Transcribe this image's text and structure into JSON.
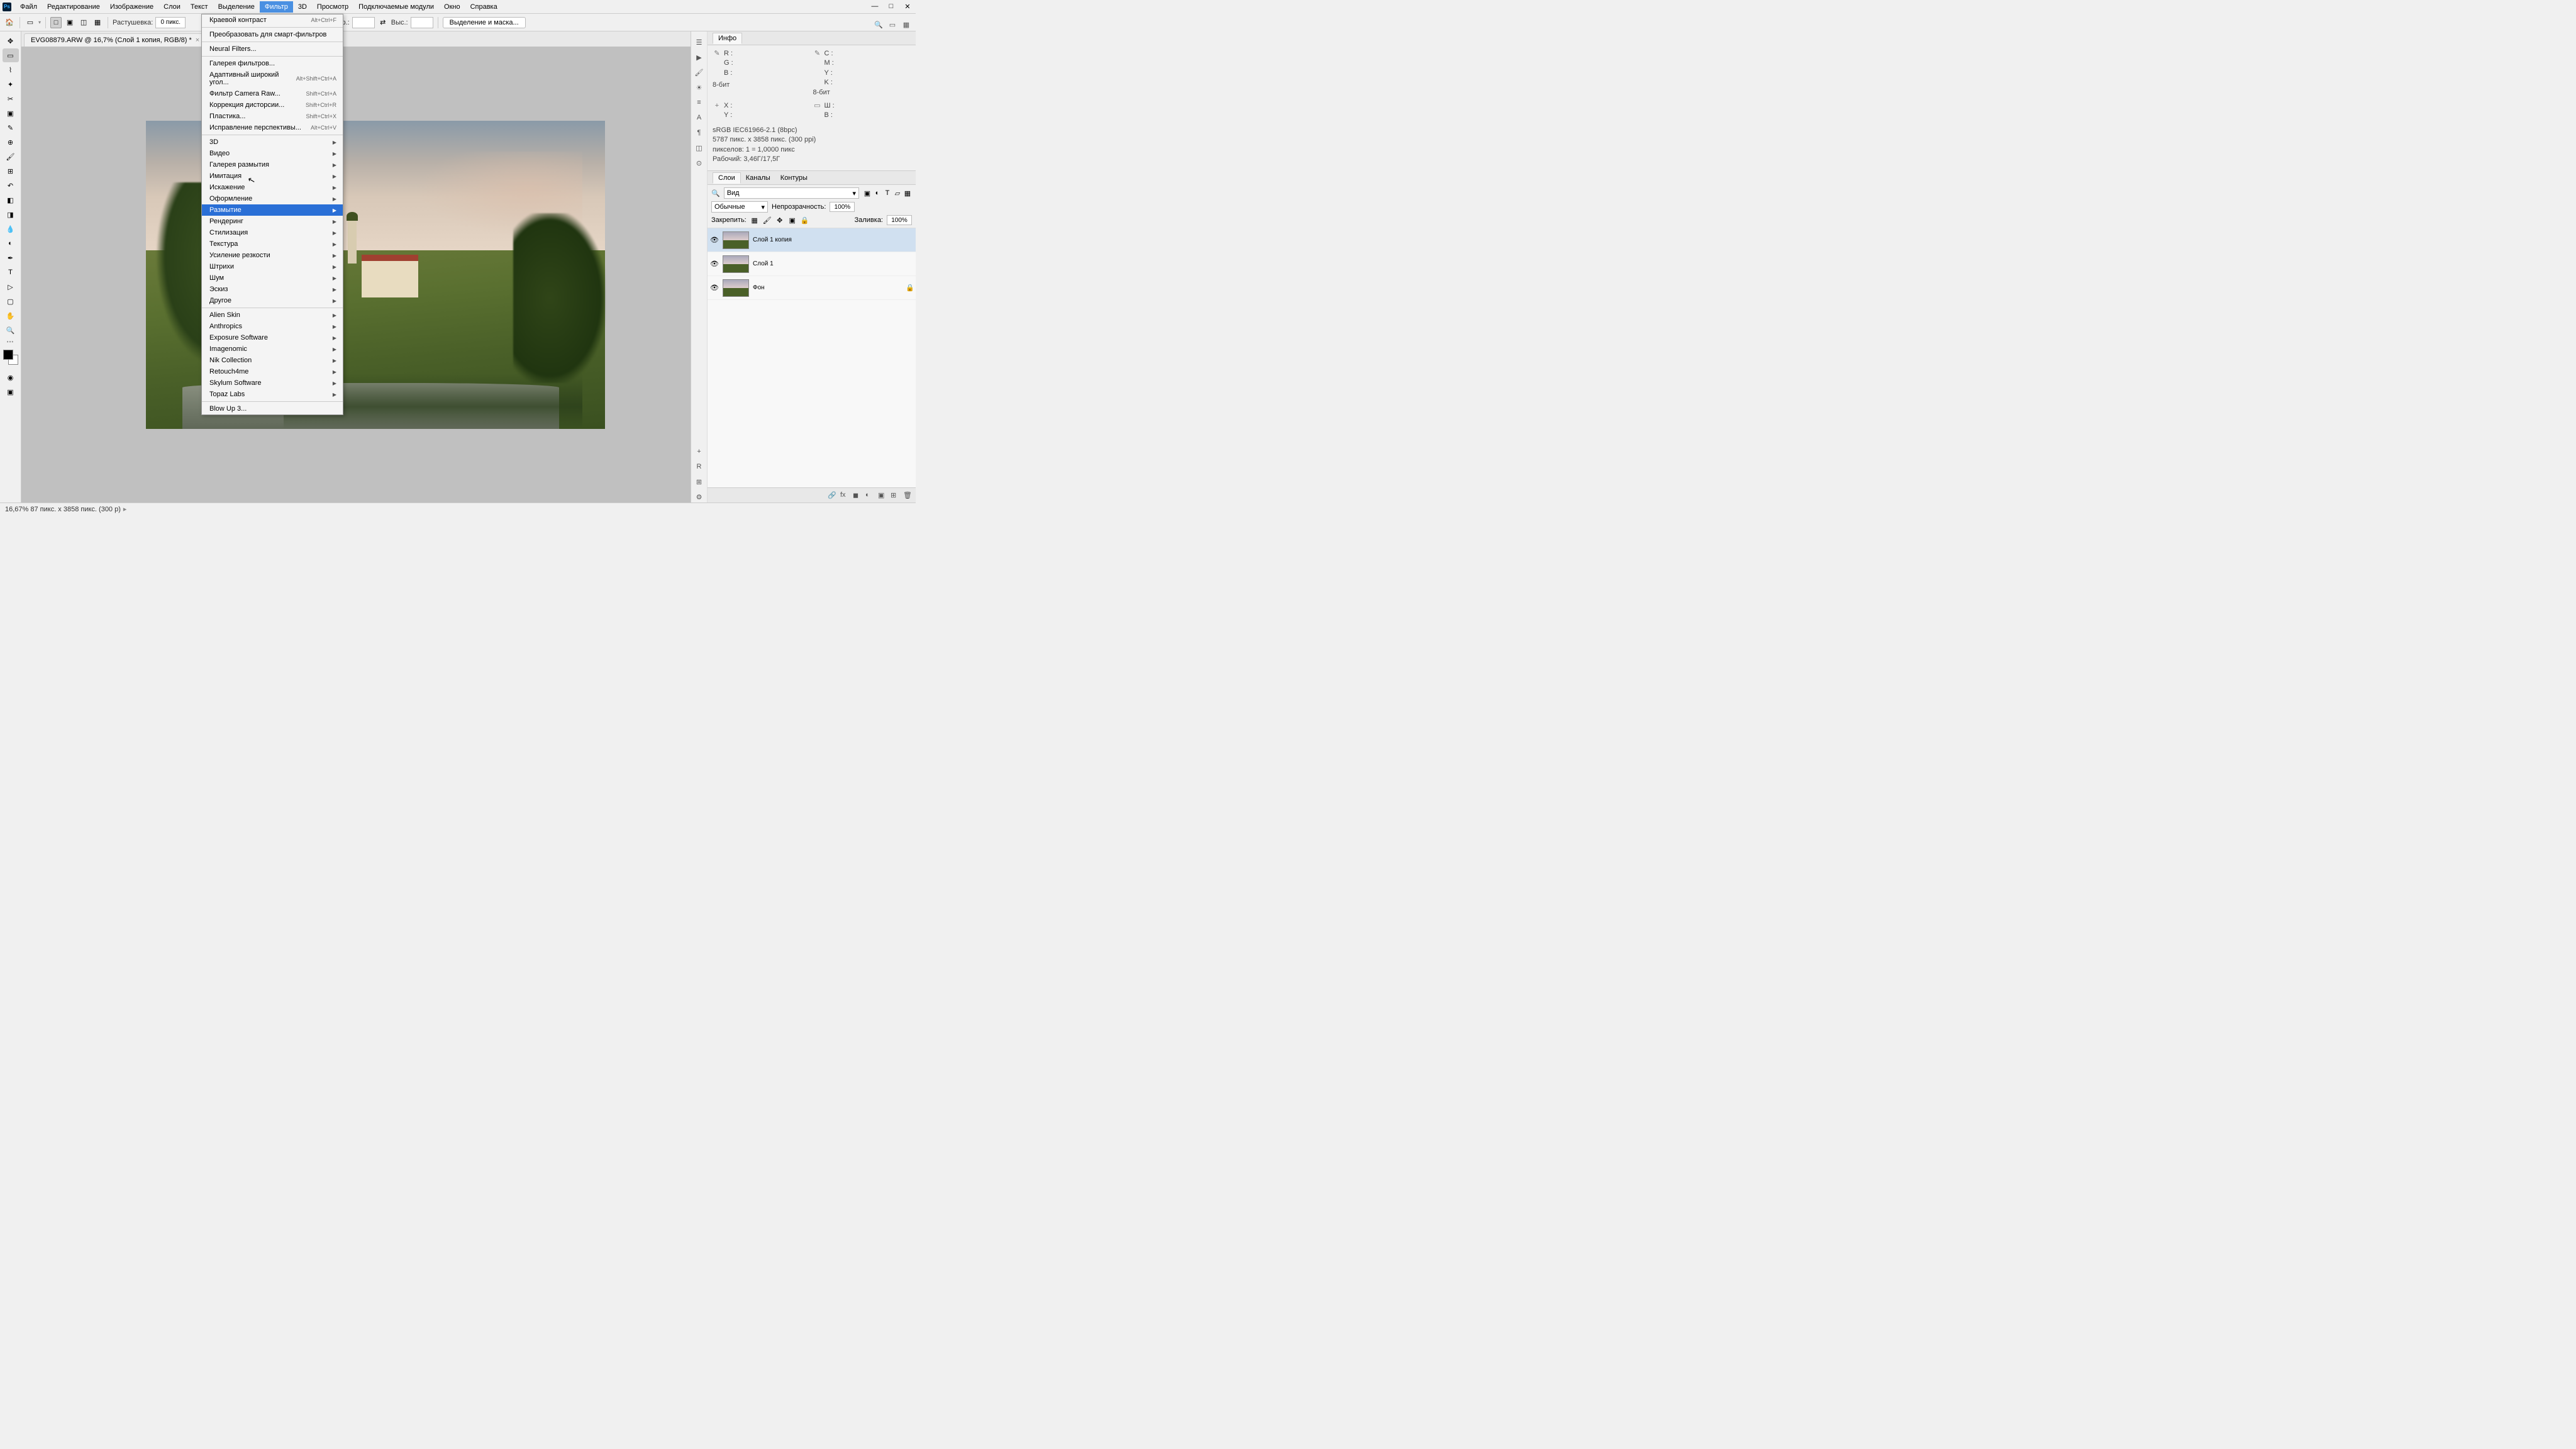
{
  "menubar": {
    "items": [
      "Файл",
      "Редактирование",
      "Изображение",
      "Слои",
      "Текст",
      "Выделение",
      "Фильтр",
      "3D",
      "Просмотр",
      "Подключаемые модули",
      "Окно",
      "Справка"
    ],
    "open_index": 6
  },
  "window_controls": {
    "min": "—",
    "max": "□",
    "close": "✕"
  },
  "optbar": {
    "feather_label": "Растушевка:",
    "feather_value": "0 пикс.",
    "width_label": "Шир.:",
    "width_value": "",
    "height_label": "Выс.:",
    "height_value": "",
    "select_mask": "Выделение и маска..."
  },
  "doc_tab": {
    "title": "EVG08879.ARW @ 16,7% (Слой 1 копия, RGB/8) *",
    "close": "×"
  },
  "dropdown": {
    "sections": [
      [
        {
          "label": "Краевой контраст",
          "shortcut": "Alt+Ctrl+F"
        }
      ],
      [
        {
          "label": "Преобразовать для смарт-фильтров"
        }
      ],
      [
        {
          "label": "Neural Filters..."
        }
      ],
      [
        {
          "label": "Галерея фильтров..."
        },
        {
          "label": "Адаптивный широкий угол...",
          "shortcut": "Alt+Shift+Ctrl+A"
        },
        {
          "label": "Фильтр Camera Raw...",
          "shortcut": "Shift+Ctrl+A"
        },
        {
          "label": "Коррекция дисторсии...",
          "shortcut": "Shift+Ctrl+R"
        },
        {
          "label": "Пластика...",
          "shortcut": "Shift+Ctrl+X"
        },
        {
          "label": "Исправление перспективы...",
          "shortcut": "Alt+Ctrl+V"
        }
      ],
      [
        {
          "label": "3D",
          "sub": true
        },
        {
          "label": "Видео",
          "sub": true
        },
        {
          "label": "Галерея размытия",
          "sub": true
        },
        {
          "label": "Имитация",
          "sub": true
        },
        {
          "label": "Искажение",
          "sub": true
        },
        {
          "label": "Оформление",
          "sub": true
        },
        {
          "label": "Размытие",
          "sub": true,
          "hl": true
        },
        {
          "label": "Рендеринг",
          "sub": true
        },
        {
          "label": "Стилизация",
          "sub": true
        },
        {
          "label": "Текстура",
          "sub": true
        },
        {
          "label": "Усиление резкости",
          "sub": true
        },
        {
          "label": "Штрихи",
          "sub": true
        },
        {
          "label": "Шум",
          "sub": true
        },
        {
          "label": "Эскиз",
          "sub": true
        },
        {
          "label": "Другое",
          "sub": true
        }
      ],
      [
        {
          "label": "Alien Skin",
          "sub": true
        },
        {
          "label": "Anthropics",
          "sub": true
        },
        {
          "label": "Exposure Software",
          "sub": true
        },
        {
          "label": "Imagenomic",
          "sub": true
        },
        {
          "label": "Nik Collection",
          "sub": true
        },
        {
          "label": "Retouch4me",
          "sub": true
        },
        {
          "label": "Skylum Software",
          "sub": true
        },
        {
          "label": "Topaz Labs",
          "sub": true
        }
      ],
      [
        {
          "label": "Blow Up 3..."
        }
      ]
    ]
  },
  "info_panel": {
    "title": "Инфо",
    "rgb": {
      "R": "R :",
      "G": "G :",
      "B": "B :",
      "depth": "8-бит"
    },
    "cmyk": {
      "C": "C :",
      "M": "M :",
      "Y": "Y :",
      "K": "K :",
      "depth": "8-бит"
    },
    "xy": {
      "X": "X :",
      "Y": "Y :"
    },
    "wh": {
      "W": "Ш :",
      "H": "В :"
    },
    "profile": "sRGB IEC61966-2.1 (8bpc)",
    "dims": "5787 пикс. x 3858 пикс. (300 ppi)",
    "pixels": "пикселов: 1 = 1,0000 пикс",
    "working": "Рабочий: 3,46Г/17,5Г"
  },
  "layers_panel": {
    "tabs": [
      "Слои",
      "Каналы",
      "Контуры"
    ],
    "kind_label": "Вид",
    "blend": "Обычные",
    "opacity_label": "Непрозрачность:",
    "opacity": "100%",
    "lock_label": "Закрепить:",
    "fill_label": "Заливка:",
    "fill": "100%",
    "layers": [
      {
        "name": "Слой 1 копия",
        "sel": true
      },
      {
        "name": "Слой 1"
      },
      {
        "name": "Фон",
        "locked": true
      }
    ]
  },
  "statusbar": {
    "text": "16,67% 87 пикс. x 3858 пикс. (300 p)"
  }
}
